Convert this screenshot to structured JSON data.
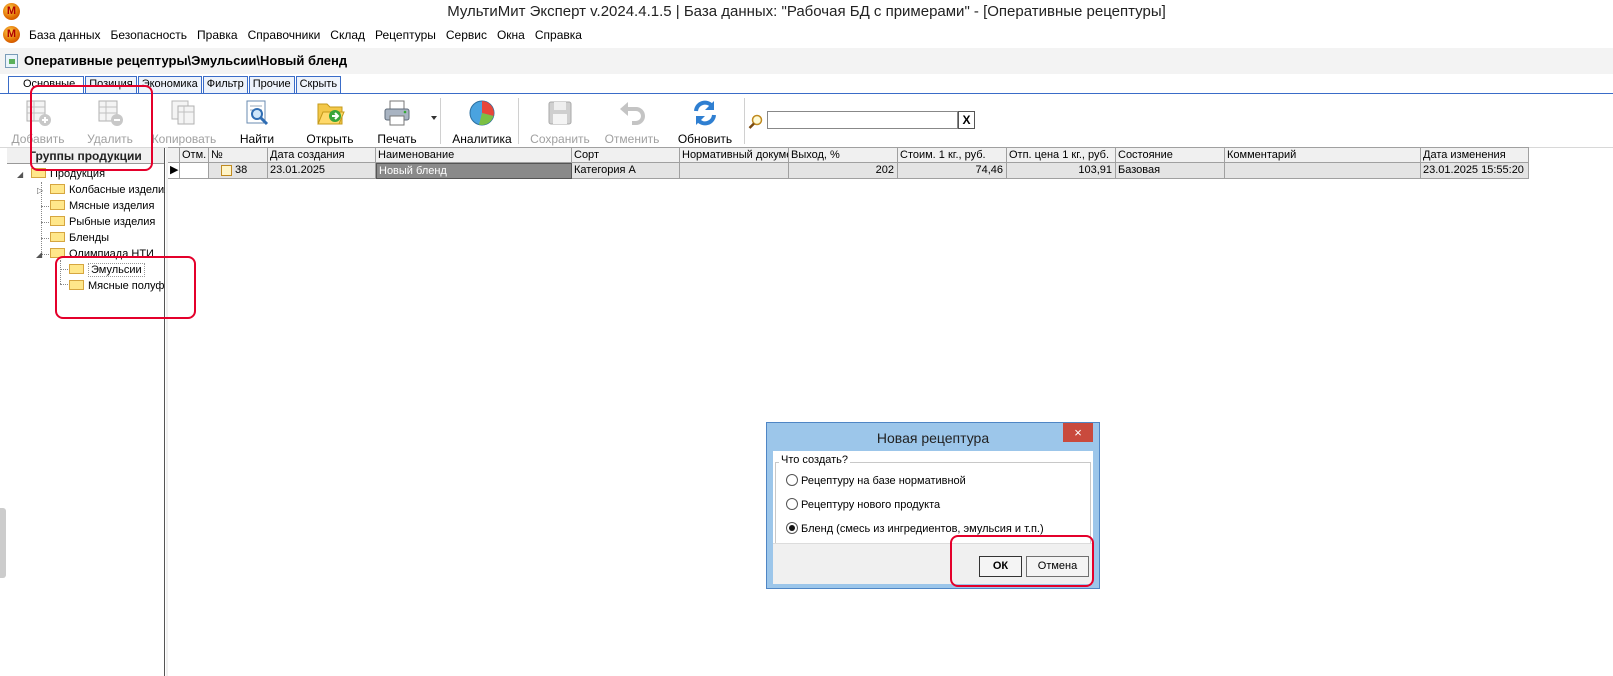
{
  "window": {
    "title": "МультиМит Эксперт v.2024.4.1.5 | База данных: \"Рабочая БД с примерами\" - [Оперативные рецептуры]",
    "logo_letter": "M"
  },
  "menu": [
    "База данных",
    "Безопасность",
    "Правка",
    "Справочники",
    "Склад",
    "Рецептуры",
    "Сервис",
    "Окна",
    "Справка"
  ],
  "document": {
    "path": "Оперативные рецептуры\\Эмульсии\\Новый бленд"
  },
  "tabs": [
    "Основные",
    "Позиция",
    "Экономика",
    "Фильтр",
    "Прочие",
    "Скрыть"
  ],
  "toolbar": {
    "add": "Добавить",
    "delete": "Удалить",
    "copy": "Копировать",
    "find": "Найти",
    "open": "Открыть",
    "print": "Печать",
    "analytics": "Аналитика",
    "save": "Сохранить",
    "cancel": "Отменить",
    "refresh": "Обновить"
  },
  "search": {
    "value": "",
    "clear": "X"
  },
  "groups": {
    "header": "Группы продукции",
    "root": "Продукция",
    "items": [
      "Колбасные изделия",
      "Мясные изделия",
      "Рыбные изделия",
      "Бленды",
      "Олимпиада НТИ"
    ],
    "sub": [
      "Эмульсии",
      "Мясные полуфабрикаты"
    ]
  },
  "grid": {
    "columns": [
      "Отм.",
      "№",
      "Дата создания",
      "Наименование",
      "Сорт",
      "Нормативный документ",
      "Выход, %",
      "Стоим. 1 кг., руб.",
      "Отп. цена 1 кг., руб.",
      "Состояние",
      "Комментарий",
      "Дата изменения"
    ],
    "rows": [
      {
        "mark": "",
        "no": "38",
        "created": "23.01.2025",
        "name": "Новый бленд",
        "grade": "Категория А",
        "normdoc": "",
        "yield": "202",
        "cost": "74,46",
        "price": "103,91",
        "state": "Базовая",
        "comment": "",
        "modified": "23.01.2025 15:55:20"
      }
    ]
  },
  "dialog": {
    "title": "Новая рецептура",
    "close": "×",
    "group": "Что создать?",
    "options": [
      "Рецептуру на базе нормативной",
      "Рецептуру нового продукта",
      "Бленд (смесь из ингредиентов, эмульсия и т.п.)"
    ],
    "selected_index": 2,
    "ok": "ОК",
    "cancel": "Отмена"
  },
  "colors": {
    "dialog_frame": "#9cc6ea",
    "tab_border": "#3a6cc8",
    "annotation": "#e4002b",
    "selected_name": "#8a8a8a"
  }
}
